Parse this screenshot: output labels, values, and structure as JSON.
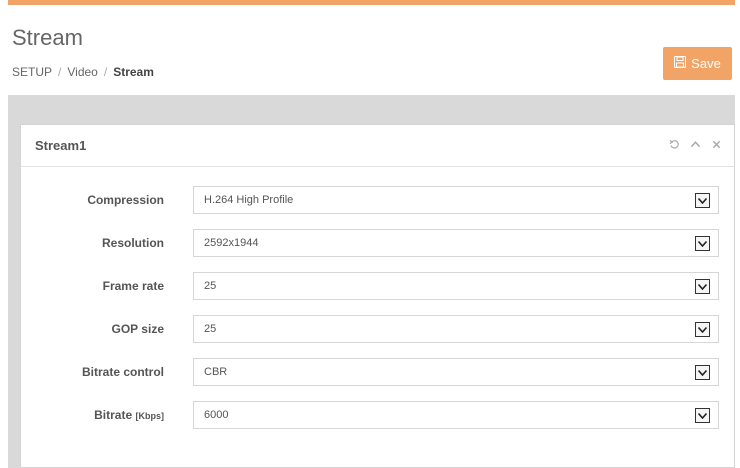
{
  "header": {
    "title": "Stream",
    "breadcrumb": [
      "SETUP",
      "Video",
      "Stream"
    ],
    "breadcrumb_sep": "/",
    "save_label": "Save"
  },
  "panel": {
    "title": "Stream1",
    "tools": [
      "refresh-icon",
      "collapse-icon",
      "close-icon"
    ]
  },
  "form": {
    "compression": {
      "label": "Compression",
      "value": "H.264 High Profile"
    },
    "resolution": {
      "label": "Resolution",
      "value": "2592x1944"
    },
    "frame_rate": {
      "label": "Frame rate",
      "value": "25"
    },
    "gop_size": {
      "label": "GOP size",
      "value": "25"
    },
    "bitrate_control": {
      "label": "Bitrate control",
      "value": "CBR"
    },
    "bitrate": {
      "label": "Bitrate",
      "unit": "[Kbps]",
      "value": "6000"
    }
  },
  "colors": {
    "accent": "#f2a466",
    "content_bg": "#d9d9d9"
  }
}
